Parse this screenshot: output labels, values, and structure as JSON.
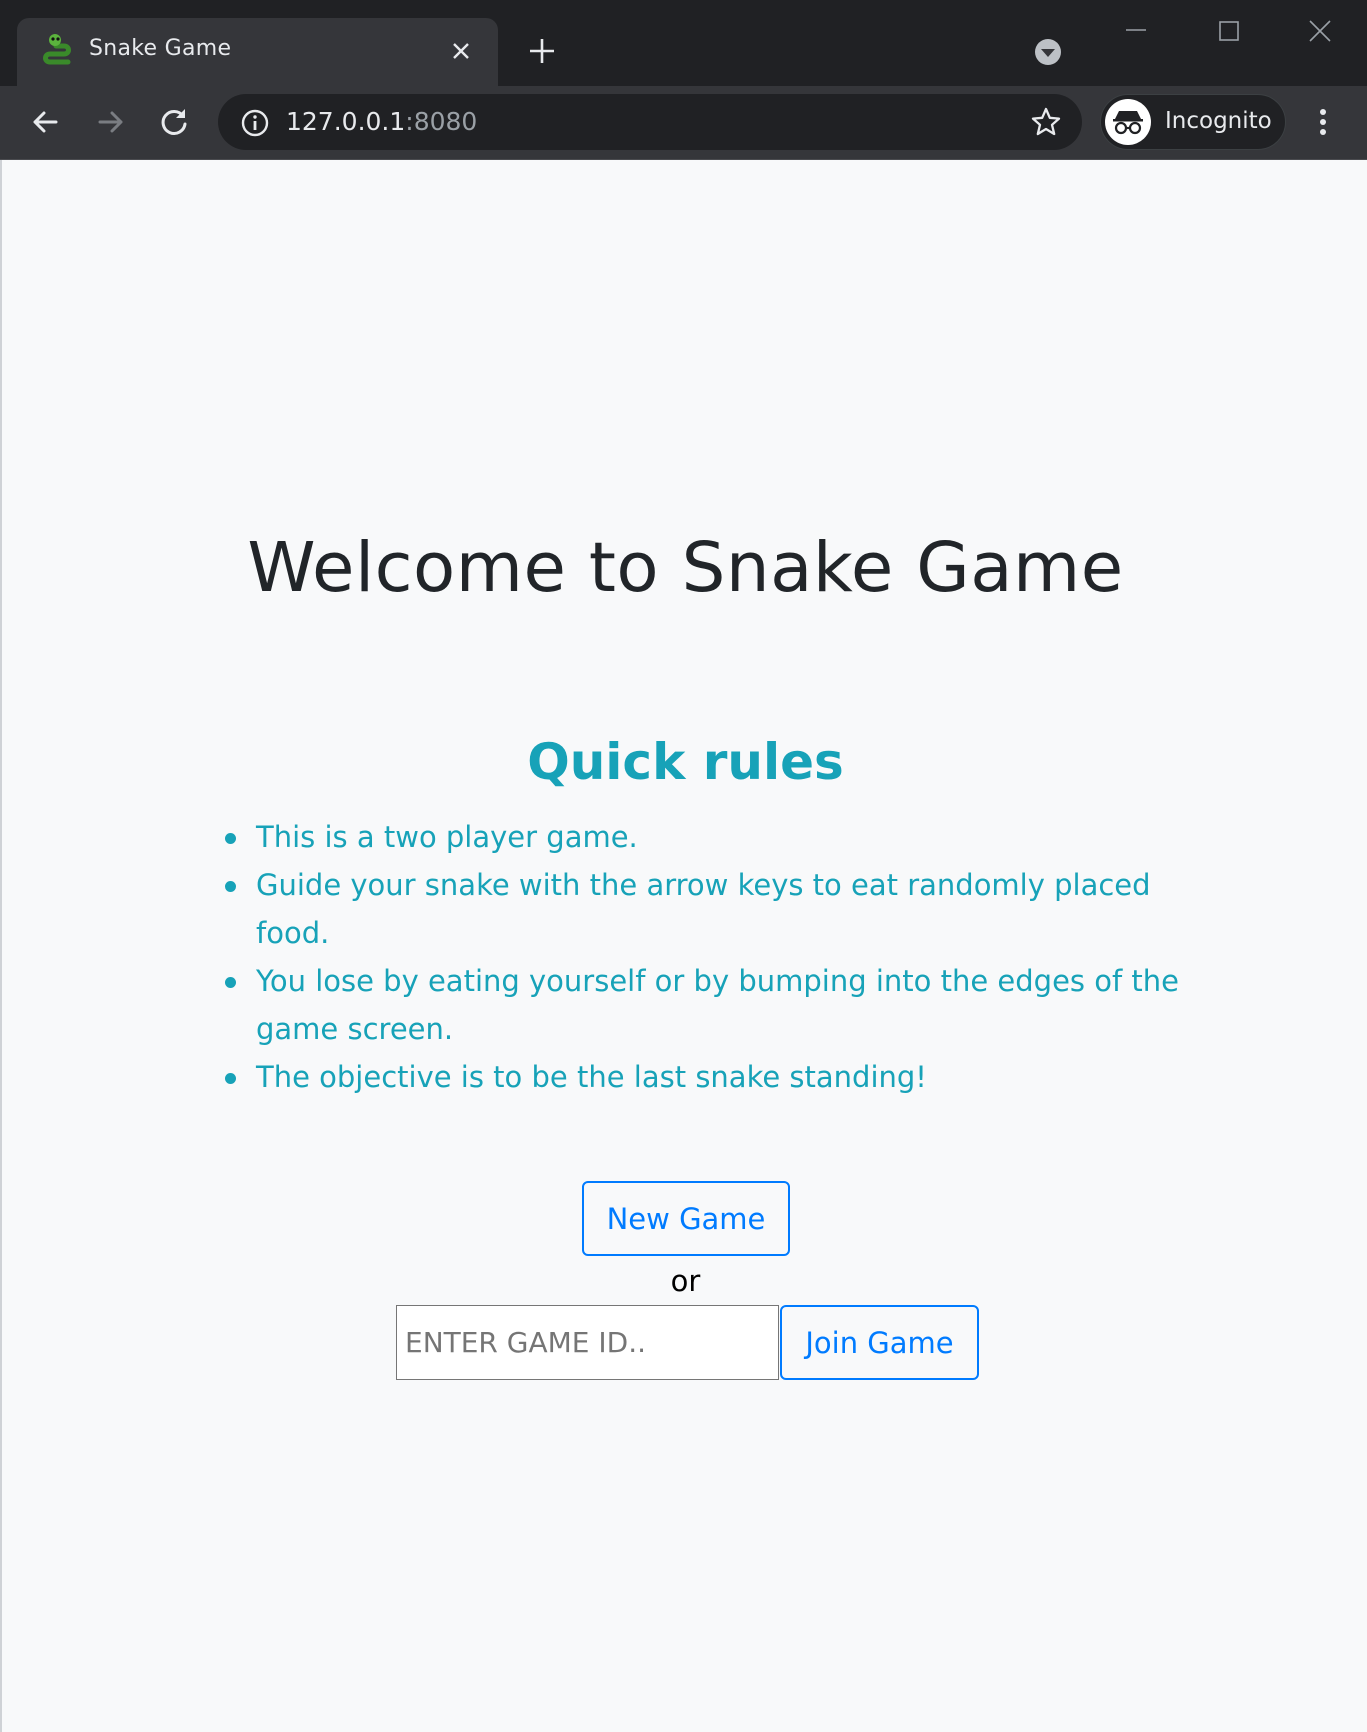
{
  "browser": {
    "tab": {
      "title": "Snake Game"
    },
    "address": {
      "host": "127.0.0.1",
      "port": ":8080"
    },
    "profile": {
      "label": "Incognito"
    }
  },
  "page": {
    "heading": "Welcome to Snake Game",
    "rules": {
      "title": "Quick rules",
      "items": [
        "This is a two player game.",
        "Guide your snake with the arrow keys to eat randomly placed food.",
        "You lose by eating yourself or by bumping into the edges of the game screen.",
        "The objective is to be the last snake standing!"
      ]
    },
    "new_game_label": "New Game",
    "or_label": "or",
    "game_id_placeholder": "ENTER GAME ID..",
    "join_game_label": "Join Game"
  },
  "colors": {
    "rules_accent": "#17a2b8",
    "button_primary": "#007bff",
    "page_background": "#f8f9fa"
  }
}
